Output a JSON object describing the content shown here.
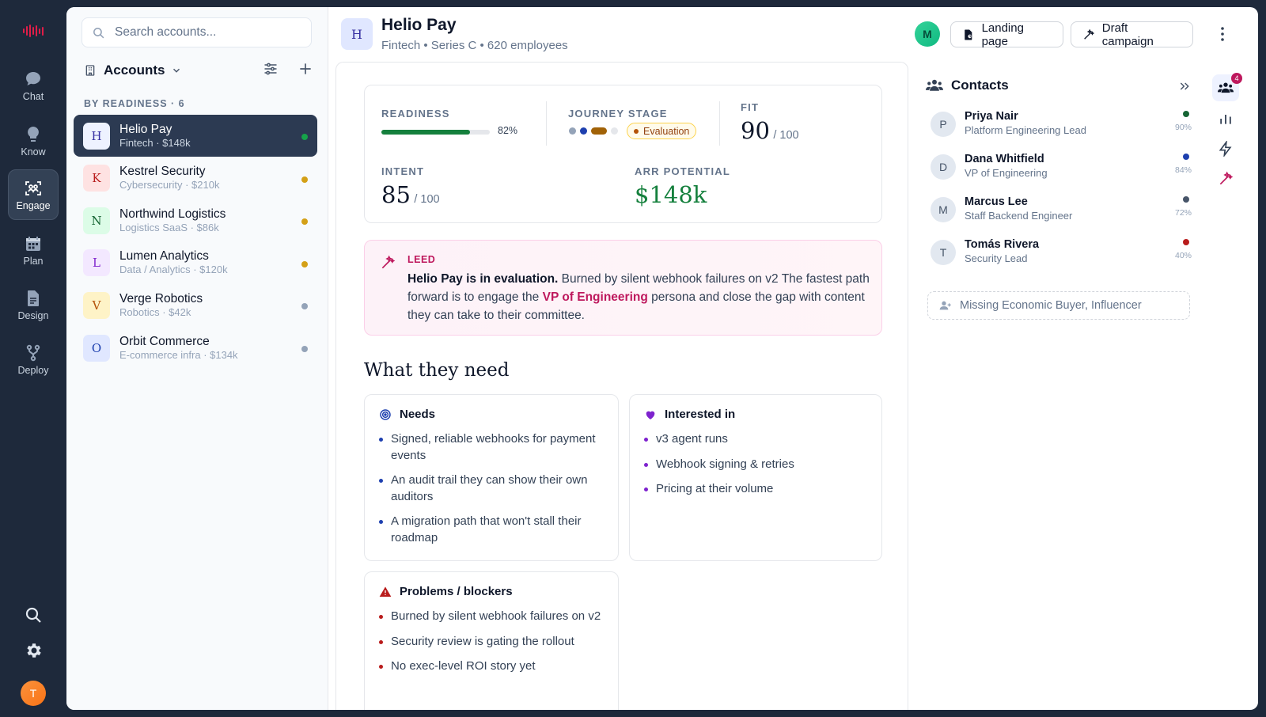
{
  "nav": {
    "items": [
      {
        "label": "Chat",
        "icon": "chat-bubble-icon"
      },
      {
        "label": "Know",
        "icon": "lightbulb-icon"
      },
      {
        "label": "Engage",
        "icon": "engage-scan-icon"
      },
      {
        "label": "Plan",
        "icon": "calendar-icon"
      },
      {
        "label": "Design",
        "icon": "document-icon"
      },
      {
        "label": "Deploy",
        "icon": "branch-icon"
      }
    ],
    "active": "Engage",
    "user_initial": "T"
  },
  "accounts_panel": {
    "search_placeholder": "Search accounts...",
    "title": "Accounts",
    "section_label": "BY READINESS · 6",
    "accounts": [
      {
        "initial": "H",
        "name": "Helio Pay",
        "sub": "Fintech · $148k",
        "status_color": "#16a34a",
        "badge_bg": "#e0e7ff",
        "badge_fg": "#3730a3"
      },
      {
        "initial": "K",
        "name": "Kestrel Security",
        "sub": "Cybersecurity · $210k",
        "status_color": "#d4a017",
        "badge_bg": "#fee2e2",
        "badge_fg": "#b91c1c"
      },
      {
        "initial": "N",
        "name": "Northwind Logistics",
        "sub": "Logistics SaaS · $86k",
        "status_color": "#d4a017",
        "badge_bg": "#dcfce7",
        "badge_fg": "#166534"
      },
      {
        "initial": "L",
        "name": "Lumen Analytics",
        "sub": "Data / Analytics · $120k",
        "status_color": "#d4a017",
        "badge_bg": "#f3e8ff",
        "badge_fg": "#7e22ce"
      },
      {
        "initial": "V",
        "name": "Verge Robotics",
        "sub": "Robotics · $42k",
        "status_color": "#94a3b8",
        "badge_bg": "#fef3c7",
        "badge_fg": "#b45309"
      },
      {
        "initial": "O",
        "name": "Orbit Commerce",
        "sub": "E-commerce infra · $134k",
        "status_color": "#94a3b8",
        "badge_bg": "#e0e7ff",
        "badge_fg": "#1e40af"
      }
    ]
  },
  "header": {
    "initial": "H",
    "name": "Helio Pay",
    "industry": "Fintech",
    "stage": "Series C",
    "employees": "620 employees",
    "user_initial": "M",
    "landing_label": "Landing page",
    "campaign_label": "Draft campaign"
  },
  "scores": {
    "readiness_label": "READINESS",
    "readiness_pct": 82,
    "readiness_text": "82%",
    "journey_label": "JOURNEY STAGE",
    "journey_stage": "Evaluation",
    "fit_label": "FIT",
    "fit_value": "90",
    "fit_of": "/ 100",
    "intent_label": "INTENT",
    "intent_value": "85",
    "intent_of": "/ 100",
    "arr_label": "ARR POTENTIAL",
    "arr_value": "$148k"
  },
  "leed": {
    "tag": "LEED",
    "headline": "Helio Pay is in evaluation.",
    "body_1": " Burned by silent webhook failures on v2 The fastest path forward is to engage the ",
    "highlight": "VP of Engineering",
    "body_2": " persona and close the gap with content they can take to their committee."
  },
  "needs_section": {
    "title": "What they need",
    "needs_title": "Needs",
    "needs": [
      "Signed, reliable webhooks for payment events",
      "An audit trail they can show their own auditors",
      "A migration path that won't stall their roadmap"
    ],
    "interested_title": "Interested in",
    "interested": [
      "v3 agent runs",
      "Webhook signing & retries",
      "Pricing at their volume"
    ],
    "problems_title": "Problems / blockers",
    "problems": [
      "Burned by silent webhook failures on v2",
      "Security review is gating the rollout",
      "No exec-level ROI story yet"
    ]
  },
  "contacts": {
    "title": "Contacts",
    "items": [
      {
        "initial": "P",
        "name": "Priya Nair",
        "role": "Platform Engineering Lead",
        "pct": "90%",
        "color": "#166534"
      },
      {
        "initial": "D",
        "name": "Dana Whitfield",
        "role": "VP of Engineering",
        "pct": "84%",
        "color": "#1e40af"
      },
      {
        "initial": "M",
        "name": "Marcus Lee",
        "role": "Staff Backend Engineer",
        "pct": "72%",
        "color": "#475569"
      },
      {
        "initial": "T",
        "name": "Tomás Rivera",
        "role": "Security Lead",
        "pct": "40%",
        "color": "#b91c1c"
      }
    ],
    "missing": "Missing Economic Buyer, Influencer"
  },
  "right_rail": {
    "contacts_badge": "4"
  }
}
